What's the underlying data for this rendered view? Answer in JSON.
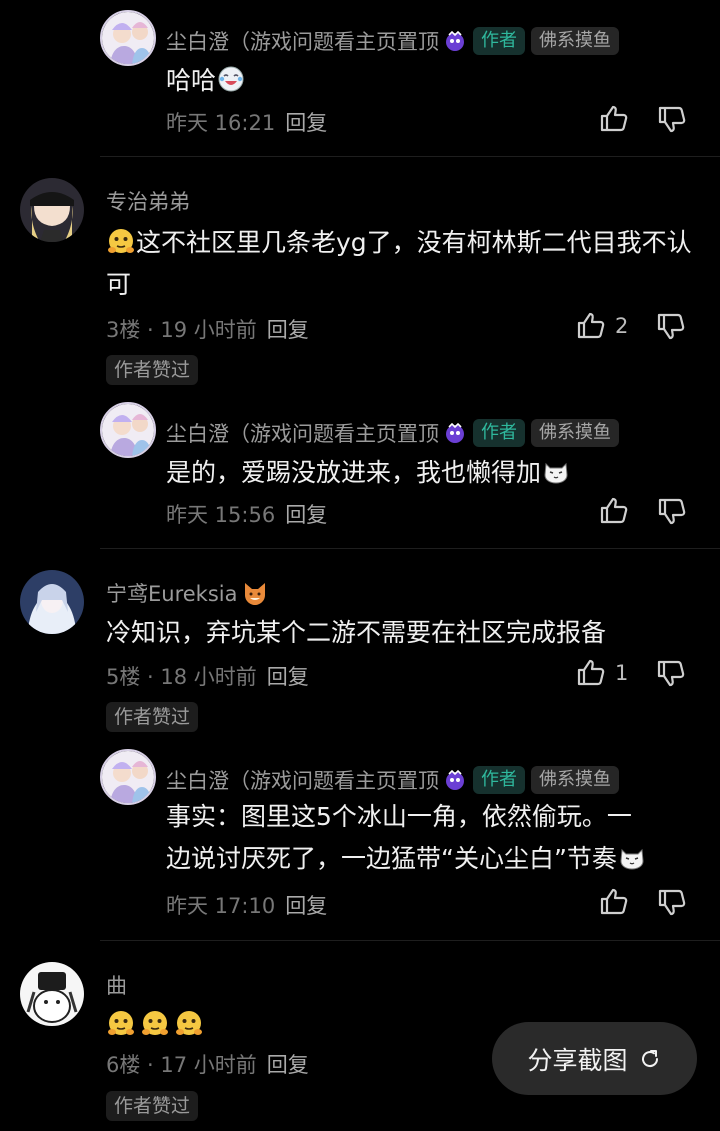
{
  "colors": {
    "background": "#000000",
    "author_tag": "#2fb89d",
    "meta": "#777777"
  },
  "share_button": {
    "label": "分享截图",
    "icon": "share-arrow-icon"
  },
  "comments": [
    {
      "kind": "reply",
      "username": "尘白澄（游戏问题看主页置顶",
      "tags": [
        "作者",
        "佛系摸鱼"
      ],
      "content": "哈哈",
      "emoji": "laugh-cry-emoji",
      "time": "昨天 16:21",
      "reply_label": "回复",
      "likes": ""
    },
    {
      "kind": "top",
      "username": "专治弟弟",
      "content": "这不社区里几条老yg了，没有柯林斯二代目我不认可",
      "emoji": "yellow-face-emoji",
      "floor_time": "3楼 · 19 小时前",
      "reply_label": "回复",
      "likes": "2",
      "approved": "作者赞过"
    },
    {
      "kind": "reply",
      "username": "尘白澄（游戏问题看主页置顶",
      "tags": [
        "作者",
        "佛系摸鱼"
      ],
      "content": "是的，爱踢没放进来，我也懒得加",
      "emoji": "cat-face-emoji",
      "time": "昨天 15:56",
      "reply_label": "回复",
      "likes": ""
    },
    {
      "kind": "top",
      "username": "宁鸢Eureksia",
      "content": "冷知识，弃坑某个二游不需要在社区完成报备",
      "floor_time": "5楼 · 18 小时前",
      "reply_label": "回复",
      "likes": "1",
      "approved": "作者赞过"
    },
    {
      "kind": "reply",
      "username": "尘白澄（游戏问题看主页置顶",
      "tags": [
        "作者",
        "佛系摸鱼"
      ],
      "content_line1": "事实：图里这5个冰山一角，依然偷玩。一",
      "content_line2": "边说讨厌死了，一边猛带“关心尘白”节奏",
      "emoji": "cat-face-emoji",
      "time": "昨天 17:10",
      "reply_label": "回复",
      "likes": ""
    },
    {
      "kind": "top",
      "username": "曲",
      "content": "",
      "emoji": "yellow-face-emoji x3",
      "floor_time": "6楼 · 17 小时前",
      "reply_label": "回复",
      "likes": "",
      "approved": "作者赞过"
    }
  ]
}
